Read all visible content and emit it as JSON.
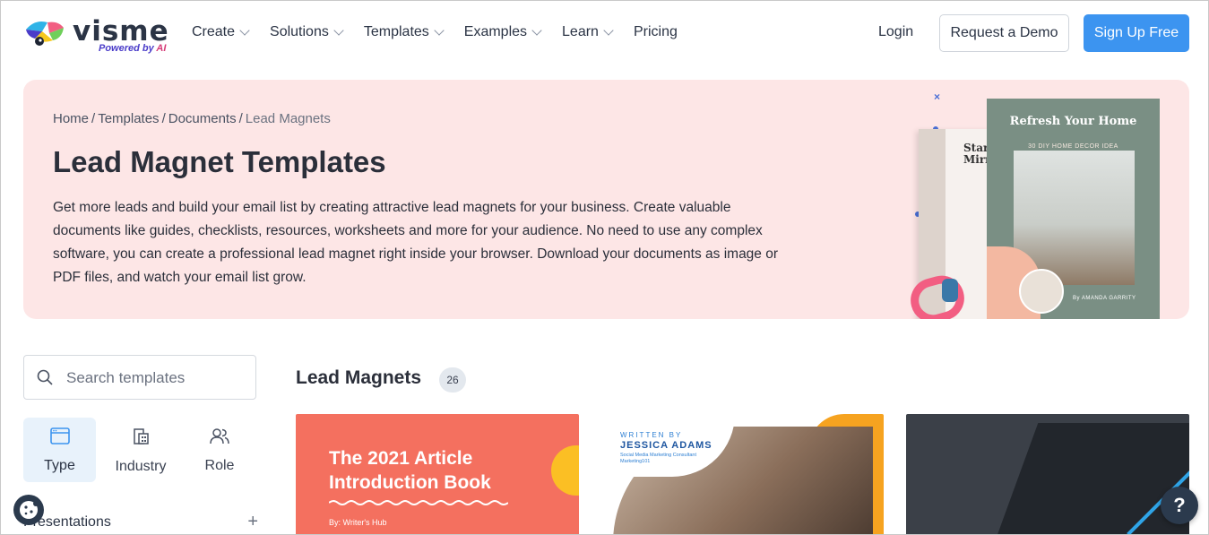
{
  "brand": {
    "name": "visme",
    "powered_prefix": "Powered by ",
    "powered_ai": "AI"
  },
  "nav": {
    "items": [
      {
        "label": "Create",
        "has_dropdown": true
      },
      {
        "label": "Solutions",
        "has_dropdown": true
      },
      {
        "label": "Templates",
        "has_dropdown": true
      },
      {
        "label": "Examples",
        "has_dropdown": true
      },
      {
        "label": "Learn",
        "has_dropdown": true
      },
      {
        "label": "Pricing",
        "has_dropdown": false
      }
    ],
    "login": "Login",
    "demo": "Request a Demo",
    "signup": "Sign Up Free"
  },
  "hero": {
    "breadcrumb": [
      "Home",
      "Templates",
      "Documents",
      "Lead Magnets"
    ],
    "title": "Lead Magnet Templates",
    "description": "Get more leads and build your email list by creating attractive lead magnets for your business. Create valuable documents like guides, checklists, resources, worksheets and more for your audience. No need to use any complex software, you can create a professional lead magnet right inside your browser. Download your documents as image or PDF files, and watch your email list grow.",
    "art": {
      "back_doc_title": "Star Mirr",
      "front_doc_title": "Refresh Your Home",
      "front_doc_subtitle": "30 DIY HOME DECOR IDEA",
      "front_doc_byline": "By AMANDA GARRITY"
    }
  },
  "sidebar": {
    "search_placeholder": "Search templates",
    "filters": [
      {
        "label": "Type",
        "icon": "browser-window-icon",
        "active": true
      },
      {
        "label": "Industry",
        "icon": "buildings-icon",
        "active": false
      },
      {
        "label": "Role",
        "icon": "users-icon",
        "active": false
      }
    ],
    "category": {
      "label": "Presentations",
      "expand": "+"
    }
  },
  "main": {
    "section_title": "Lead Magnets",
    "count": "26",
    "cards": [
      {
        "title": "The 2021 Article Introduction Book",
        "byline": "By: Writer's Hub"
      },
      {
        "written_by": "WRITTEN BY",
        "author": "JESSICA ADAMS",
        "role": "Social Media Marketing Consultant Marketing101"
      },
      {
        "theme": "code-screen"
      }
    ]
  },
  "widgets": {
    "help": "?"
  },
  "colors": {
    "accent": "#3c94f0",
    "hero_bg": "#fde6e6",
    "card1_bg": "#f4705f",
    "card2_accent": "#f6a320"
  }
}
